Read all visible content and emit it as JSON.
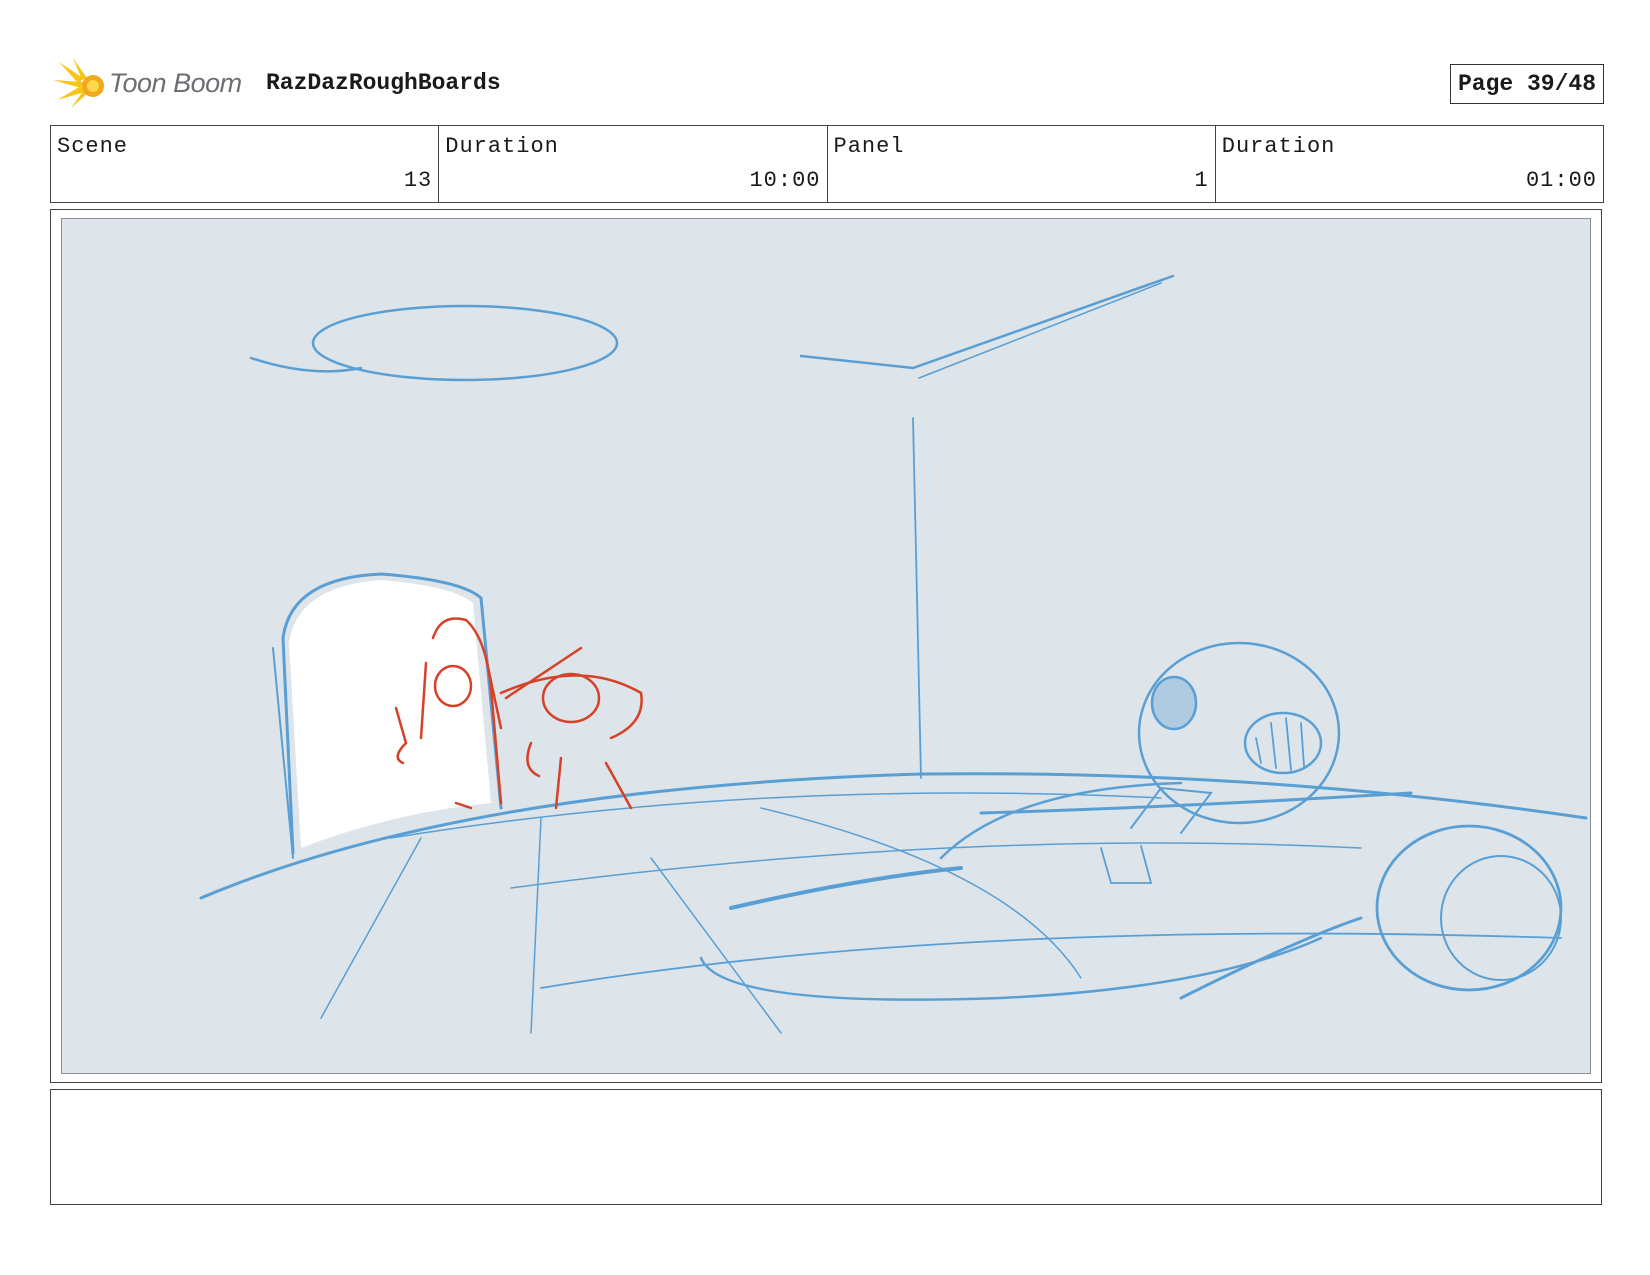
{
  "header": {
    "logo_text": "Toon Boom",
    "project_name": "RazDazRoughBoards",
    "page_label": "Page 39/48"
  },
  "info": {
    "scene_label": "Scene",
    "scene_value": "13",
    "scene_duration_label": "Duration",
    "scene_duration_value": "10:00",
    "panel_label": "Panel",
    "panel_value": "1",
    "panel_duration_label": "Duration",
    "panel_duration_value": "01:00"
  },
  "colors": {
    "sketch_blue": "#5a9fd4",
    "sketch_red": "#d64228",
    "panel_bg": "#dde4ea",
    "logo_yellow": "#f5c518"
  },
  "notes": {
    "text": ""
  }
}
